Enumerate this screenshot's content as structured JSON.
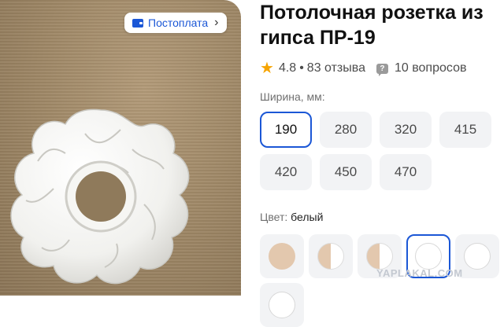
{
  "badge": {
    "label": "Постоплата",
    "icon": "wallet-icon"
  },
  "product": {
    "title": "Потолочная розетка из\nгипса ПР-19",
    "rating": "4.8",
    "separator": "•",
    "reviews": "83 отзыва",
    "questions": "10 вопросов"
  },
  "width": {
    "label": "Ширина, мм:",
    "selected": "190",
    "options": [
      "190",
      "280",
      "320",
      "415",
      "420",
      "450",
      "470"
    ]
  },
  "color": {
    "label": "Цвет:",
    "value": "белый",
    "swatches": [
      {
        "fill": "#e3c8ae",
        "style": "solid"
      },
      {
        "fill": "#e3c8ae",
        "style": "half"
      },
      {
        "fill": "#e3c8ae",
        "style": "half"
      },
      {
        "fill": "#ffffff",
        "style": "white",
        "selected": true
      },
      {
        "fill": "#ffffff",
        "style": "white"
      },
      {
        "fill": "#ffffff",
        "style": "white"
      }
    ]
  },
  "watermark": "YAPLAKAL.COM",
  "colors": {
    "accent": "#1b57d6",
    "star": "#f6a400",
    "chip_bg": "#f2f3f5"
  }
}
